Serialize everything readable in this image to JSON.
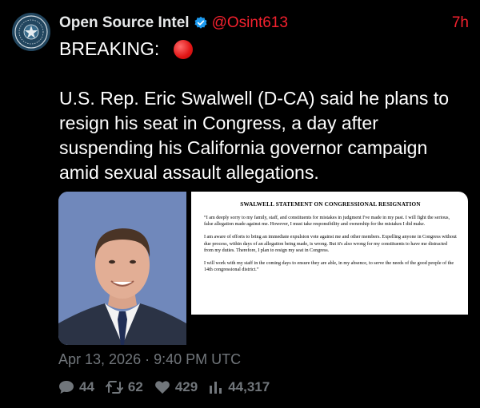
{
  "author": {
    "display_name": "Open Source Intel",
    "handle": "@Osint613",
    "verified_icon": "verified-badge-icon"
  },
  "time_ago": "7h",
  "tweet": {
    "text": "BREAKING:\n\nU.S. Rep. Eric Swalwell (D-CA) said he plans to resign his seat in Congress, a day after suspending his California governor campaign amid sexual assault allegations.",
    "emoji_icon": "red-circle-icon"
  },
  "media": {
    "photo_icon": "portrait-photo",
    "document": {
      "title": "SWALWELL STATEMENT ON CONGRESSIONAL RESIGNATION",
      "paragraphs": [
        "“I am deeply sorry to my family, staff, and constituents for mistakes in judgment I've made in my past. I will fight the serious, false allegation made against me. However, I must take responsibility and ownership for the mistakes I did make.",
        "I am aware of efforts to bring an immediate expulsion vote against me and other members. Expelling anyone in Congress without due process, within days of an allegation being made, is wrong. But it's also wrong for my constituents to have me distracted from my duties. Therefore, I plan to resign my seat in Congress.",
        "I will work with my staff in the coming days to ensure they are able, in my absence, to serve the needs of the good people of the 14th congressional district.”"
      ]
    }
  },
  "meta": {
    "timestamp": "Apr 13, 2026 · 9:40 PM UTC"
  },
  "stats": {
    "replies": "44",
    "retweets": "62",
    "likes": "429",
    "views": "44,317"
  },
  "colors": {
    "background": "#000000",
    "accent_red": "#f4212e",
    "verified_blue": "#1d9bf0",
    "muted": "#71767b"
  }
}
